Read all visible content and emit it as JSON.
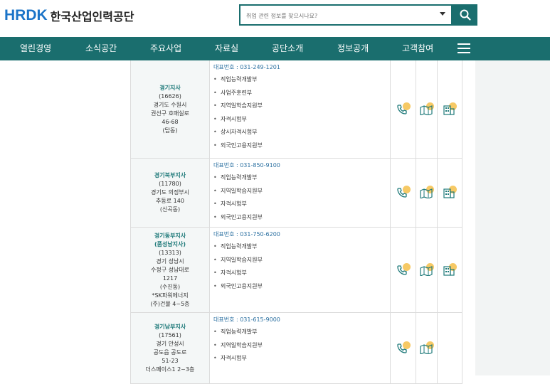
{
  "header": {
    "logo_mark": "HRDK",
    "logo_text": "한국산업인력공단",
    "search_placeholder": "취업 관련 정보를 찾으시나요?"
  },
  "nav": {
    "items": [
      "열린경영",
      "소식공간",
      "주요사업",
      "자료실",
      "공단소개",
      "정보공개",
      "고객참여"
    ]
  },
  "branches": [
    {
      "name": [
        "경기지사"
      ],
      "address": [
        "(16626)",
        "경기도 수원시",
        "권선구 호매실로",
        "46-68",
        "(탑동)"
      ],
      "phone": "대표번호 : 031-249-1201",
      "depts": [
        "직업능력개발부",
        "사업주훈련부",
        "지역일학습지원부",
        "자격시험부",
        "상시자격시험부",
        "외국인고용지원부"
      ],
      "has_building_icon": true
    },
    {
      "name": [
        "경기북부지사"
      ],
      "address": [
        "(11780)",
        "경기도 의정부시",
        "추동로 140",
        "(신곡동)"
      ],
      "phone": "대표번호 : 031-850-9100",
      "depts": [
        "직업능력개발부",
        "지역일학습지원부",
        "자격시험부",
        "외국인고용지원부"
      ],
      "has_building_icon": true
    },
    {
      "name": [
        "경기동부지사",
        "(품성남지사)"
      ],
      "address": [
        "(13313)",
        "경기 성남시",
        "수정구 성남대로",
        "1217",
        "(수진동)",
        "*SK파워에너지",
        "(주)건물 4~5층"
      ],
      "phone": "대표번호 : 031-750-6200",
      "depts": [
        "직업능력개발부",
        "지역일학습지원부",
        "자격시험부",
        "외국인고용지원부"
      ],
      "has_building_icon": true
    },
    {
      "name": [
        "경기남부지사"
      ],
      "address": [
        "(17561)",
        "경기 안성시",
        "공도읍 공도로",
        "51-23",
        "더스페이스1 2~3층"
      ],
      "phone": "대표번호 : 031-615-9000",
      "depts": [
        "직업능력개발부",
        "지역일학습지원부",
        "자격시험부"
      ],
      "has_building_icon": false
    }
  ],
  "icons": {
    "phone": "phone-icon",
    "map": "map-icon",
    "building": "building-icon",
    "accent": "#f5c04a",
    "teal": "#1a6e6e"
  }
}
